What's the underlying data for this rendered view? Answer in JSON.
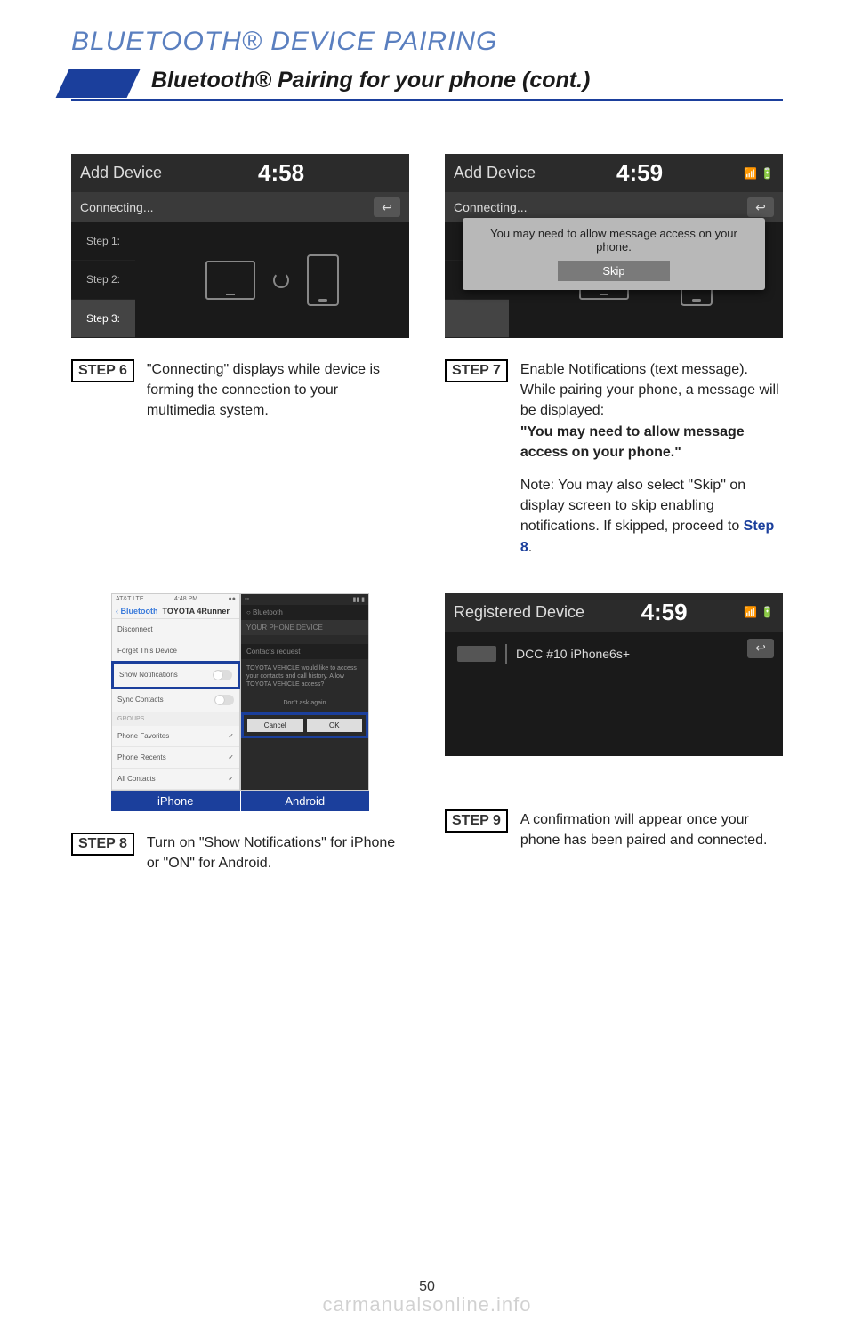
{
  "section_header": "BLUETOOTH® DEVICE PAIRING",
  "page_title": "Bluetooth® Pairing for your phone (cont.)",
  "page_number": "50",
  "watermark": "carmanualsonline.info",
  "screen6": {
    "title": "Add Device",
    "time": "4:58",
    "subtitle": "Connecting...",
    "steps": [
      "Step 1:",
      "Step 2:",
      "Step 3:"
    ]
  },
  "screen7": {
    "title": "Add Device",
    "time": "4:59",
    "subtitle": "Connecting...",
    "popup_text": "You may need to allow message access on your phone.",
    "popup_button": "Skip"
  },
  "screen9": {
    "title": "Registered Device",
    "time": "4:59",
    "device_name": "DCC #10 iPhone6s+"
  },
  "phone_iphone": {
    "carrier": "AT&T  LTE",
    "clock": "4:48 PM",
    "back": "Bluetooth",
    "header": "TOYOTA 4Runner",
    "rows": {
      "disconnect": "Disconnect",
      "forget": "Forget This Device",
      "show_notifications": "Show Notifications",
      "sync_contacts": "Sync Contacts",
      "groups": "GROUPS",
      "favorites": "Phone Favorites",
      "recents": "Phone Recents",
      "all": "All Contacts"
    }
  },
  "phone_android": {
    "dialog_title": "Contacts request",
    "dialog_body": "TOYOTA VEHICLE would like to access your contacts and call history. Allow TOYOTA VEHICLE access?",
    "dont_ask": "Don't ask again",
    "cancel": "Cancel",
    "ok": "OK"
  },
  "phone_labels": {
    "iphone": "iPhone",
    "android": "Android"
  },
  "step6": {
    "label": "STEP 6",
    "text": "\"Connecting\" displays while device is forming the connection to your multimedia system."
  },
  "step7": {
    "label": "STEP 7",
    "p1": "Enable Notifications (text message). While pairing your phone, a message will be displayed:",
    "bold": "\"You may need to allow message access on your phone.\"",
    "note_prefix": "Note: You may also select \"Skip\" on display screen to skip enabling notifications. If skipped, proceed to ",
    "note_link": "Step 8",
    "note_suffix": "."
  },
  "step8": {
    "label": "STEP 8",
    "text": "Turn on \"Show Notifications\" for iPhone or \"ON\" for Android."
  },
  "step9": {
    "label": "STEP 9",
    "text": "A confirmation will appear once your phone has been paired and connected."
  }
}
